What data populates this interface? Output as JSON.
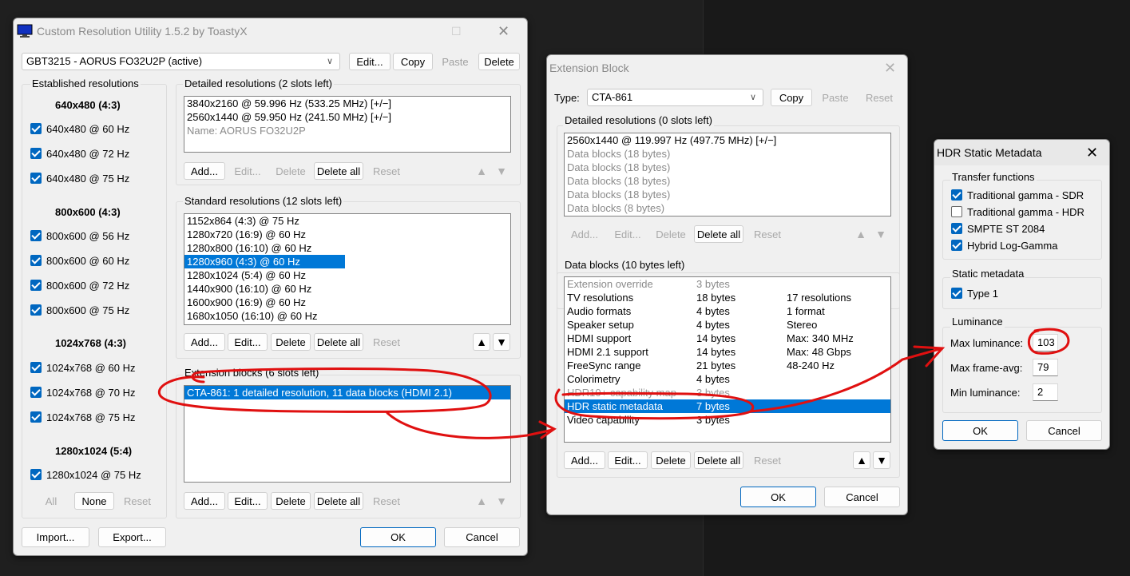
{
  "main": {
    "title": "Custom Resolution Utility 1.5.2 by ToastyX",
    "monitor": "GBT3215 - AORUS FO32U2P (active)",
    "edit": "Edit...",
    "copy": "Copy",
    "paste": "Paste",
    "delete": "Delete",
    "established_title": "Established resolutions",
    "est_groups": [
      {
        "header": "640x480 (4:3)",
        "items": [
          "640x480 @ 60 Hz",
          "640x480 @ 72 Hz",
          "640x480 @ 75 Hz"
        ]
      },
      {
        "header": "800x600 (4:3)",
        "items": [
          "800x600 @ 56 Hz",
          "800x600 @ 60 Hz",
          "800x600 @ 72 Hz",
          "800x600 @ 75 Hz"
        ]
      },
      {
        "header": "1024x768 (4:3)",
        "items": [
          "1024x768 @ 60 Hz",
          "1024x768 @ 70 Hz",
          "1024x768 @ 75 Hz"
        ]
      },
      {
        "header": "1280x1024 (5:4)",
        "items": [
          "1280x1024 @ 75 Hz"
        ]
      }
    ],
    "all": "All",
    "none": "None",
    "reset": "Reset",
    "detailed_title": "Detailed resolutions (2 slots left)",
    "detailed_items": [
      "3840x2160 @ 59.996 Hz (533.25 MHz) [+/−]",
      "2560x1440 @ 59.950 Hz (241.50 MHz) [+/−]",
      "Name: AORUS FO32U2P"
    ],
    "add": "Add...",
    "delete_all": "Delete all",
    "standard_title": "Standard resolutions (12 slots left)",
    "standard_items": [
      "1152x864 (4:3) @ 75 Hz",
      "1280x720 (16:9) @ 60 Hz",
      "1280x800 (16:10) @ 60 Hz",
      "1280x960 (4:3) @ 60 Hz",
      "1280x1024 (5:4) @ 60 Hz",
      "1440x900 (16:10) @ 60 Hz",
      "1600x900 (16:9) @ 60 Hz",
      "1680x1050 (16:10) @ 60 Hz"
    ],
    "ext_title": "Extension blocks (6 slots left)",
    "ext_items": [
      "CTA-861: 1 detailed resolution, 11 data blocks (HDMI 2.1)"
    ],
    "import": "Import...",
    "export": "Export...",
    "ok": "OK",
    "cancel": "Cancel",
    "up": "▲",
    "down": "▼"
  },
  "ext": {
    "title": "Extension Block",
    "type_label": "Type:",
    "type_value": "CTA-861",
    "copy": "Copy",
    "paste": "Paste",
    "reset": "Reset",
    "detailed_title": "Detailed resolutions (0 slots left)",
    "detailed_items": [
      "2560x1440 @ 119.997 Hz (497.75 MHz) [+/−]",
      "Data blocks (18 bytes)",
      "Data blocks (18 bytes)",
      "Data blocks (18 bytes)",
      "Data blocks (18 bytes)",
      "Data blocks (8 bytes)"
    ],
    "add": "Add...",
    "edit": "Edit...",
    "delete": "Delete",
    "delete_all": "Delete all",
    "data_title": "Data blocks (10 bytes left)",
    "data_rows": [
      {
        "name": "Extension override",
        "bytes": "3 bytes",
        "info": ""
      },
      {
        "name": "TV resolutions",
        "bytes": "18 bytes",
        "info": "17 resolutions"
      },
      {
        "name": "Audio formats",
        "bytes": "4 bytes",
        "info": "1 format"
      },
      {
        "name": "Speaker setup",
        "bytes": "4 bytes",
        "info": "Stereo"
      },
      {
        "name": "HDMI support",
        "bytes": "14 bytes",
        "info": "Max: 340 MHz"
      },
      {
        "name": "HDMI 2.1 support",
        "bytes": "14 bytes",
        "info": "Max: 48 Gbps"
      },
      {
        "name": "FreeSync range",
        "bytes": "21 bytes",
        "info": "48-240 Hz"
      },
      {
        "name": "Colorimetry",
        "bytes": "4 bytes",
        "info": ""
      },
      {
        "name": "HDR10+ capability map",
        "bytes": "3 bytes",
        "info": ""
      },
      {
        "name": "HDR static metadata",
        "bytes": "7 bytes",
        "info": ""
      },
      {
        "name": "Video capability",
        "bytes": "3 bytes",
        "info": ""
      }
    ],
    "ok": "OK",
    "cancel": "Cancel",
    "up": "▲",
    "down": "▼"
  },
  "hdr": {
    "title": "HDR Static Metadata",
    "transfer_title": "Transfer functions",
    "transfer": [
      {
        "label": "Traditional gamma - SDR",
        "checked": true
      },
      {
        "label": "Traditional gamma - HDR",
        "checked": false
      },
      {
        "label": "SMPTE ST 2084",
        "checked": true
      },
      {
        "label": "Hybrid Log-Gamma",
        "checked": true
      }
    ],
    "static_title": "Static metadata",
    "static_type": "Type 1",
    "lum_title": "Luminance",
    "max_lum_label": "Max luminance:",
    "max_lum": "103",
    "max_frame_label": "Max frame-avg:",
    "max_frame": "79",
    "min_lum_label": "Min luminance:",
    "min_lum": "2",
    "ok": "OK",
    "cancel": "Cancel"
  },
  "colors": {
    "accent": "#0078d7",
    "annotation": "#e01010"
  }
}
